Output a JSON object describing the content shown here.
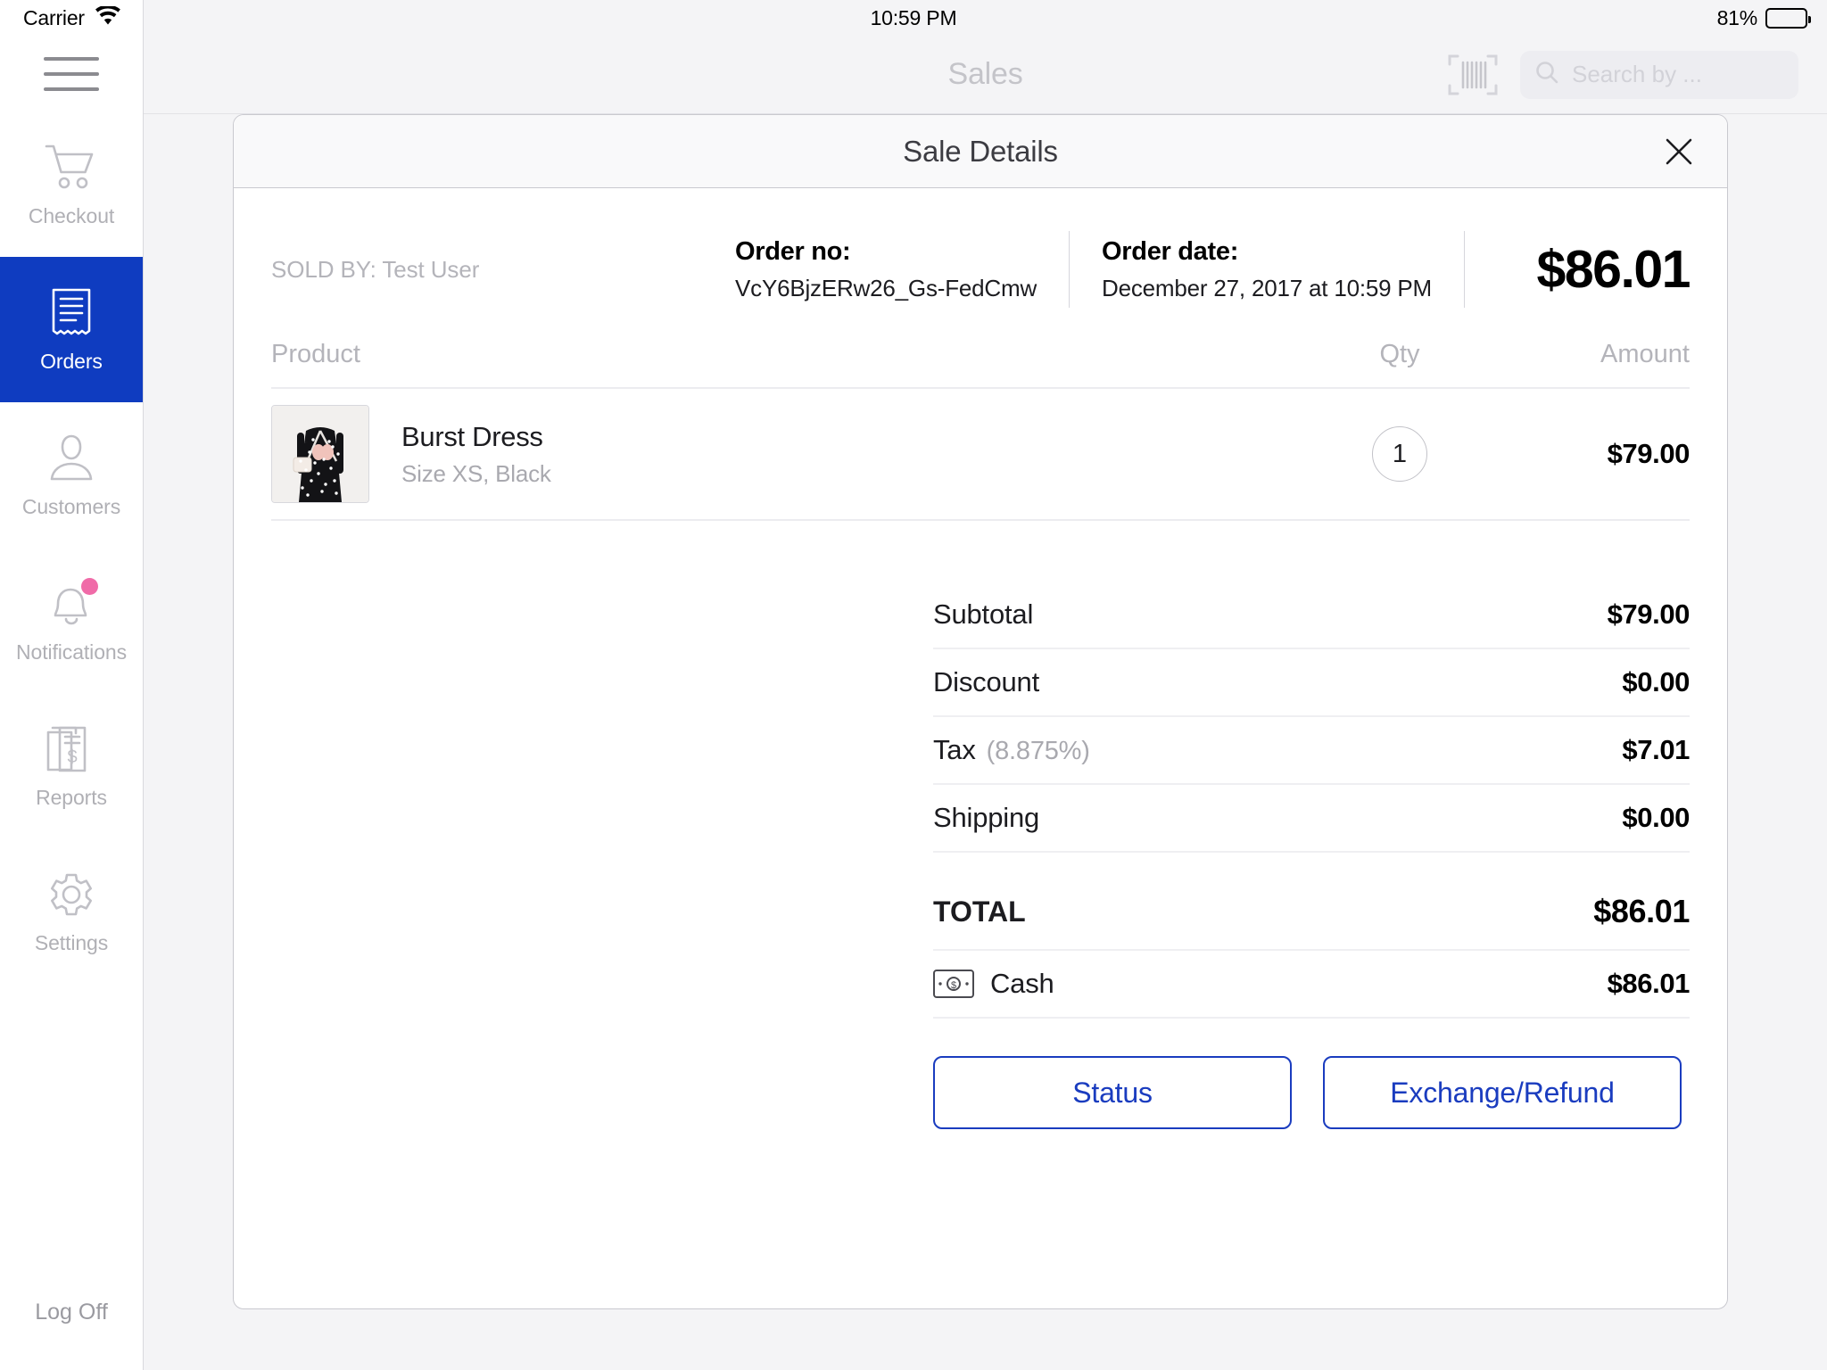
{
  "status_bar": {
    "carrier": "Carrier",
    "time": "10:59 PM",
    "battery_percent": "81%"
  },
  "sidebar": {
    "menu_icon": "hamburger-icon",
    "items": [
      {
        "label": "Checkout",
        "icon": "shopping-cart-icon",
        "active": false,
        "badge": false
      },
      {
        "label": "Orders",
        "icon": "receipt-icon",
        "active": true,
        "badge": false
      },
      {
        "label": "Customers",
        "icon": "person-icon",
        "active": false,
        "badge": false
      },
      {
        "label": "Notifications",
        "icon": "bell-icon",
        "active": false,
        "badge": true
      },
      {
        "label": "Reports",
        "icon": "documents-dollar-icon",
        "active": false,
        "badge": false
      },
      {
        "label": "Settings",
        "icon": "gear-icon",
        "active": false,
        "badge": false
      }
    ],
    "log_off": "Log Off",
    "active_color": "#0f3cc0"
  },
  "navbar": {
    "title": "Sales",
    "barcode_icon": "barcode-scan-icon",
    "search": {
      "icon": "search-icon",
      "value": "",
      "placeholder": "Search by ..."
    }
  },
  "modal": {
    "title": "Sale Details",
    "close_icon": "close-icon",
    "order": {
      "sold_by": "SOLD BY: Test User",
      "order_no_label": "Order no:",
      "order_no_value": "VcY6BjzERw26_Gs-FedCmw",
      "order_date_label": "Order date:",
      "order_date_value": "December 27, 2017 at 10:59 PM",
      "grand_total": "$86.01"
    },
    "table": {
      "headers": {
        "product": "Product",
        "qty": "Qty",
        "amount": "Amount"
      },
      "rows": [
        {
          "name": "Burst Dress",
          "variant": "Size XS, Black",
          "qty": "1",
          "amount": "$79.00",
          "image_alt": "black-polka-dot-dress-thumbnail"
        }
      ]
    },
    "totals": [
      {
        "label": "Subtotal",
        "sub": "",
        "value": "$79.00"
      },
      {
        "label": "Discount",
        "sub": "",
        "value": "$0.00"
      },
      {
        "label": "Tax",
        "sub": "(8.875%)",
        "value": "$7.01"
      },
      {
        "label": "Shipping",
        "sub": "",
        "value": "$0.00"
      }
    ],
    "total": {
      "label": "TOTAL",
      "value": "$86.01"
    },
    "payment": {
      "icon": "cash-icon",
      "label": "Cash",
      "value": "$86.01"
    },
    "actions": {
      "status_label": "Status",
      "exchange_label": "Exchange/Refund",
      "accent_color": "#1a3cbf"
    }
  }
}
